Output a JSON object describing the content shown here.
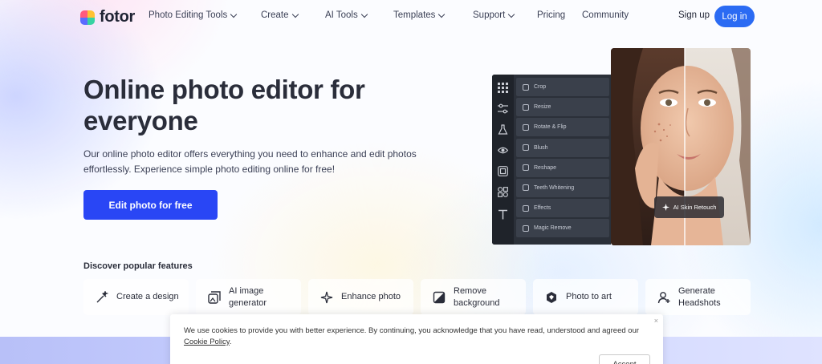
{
  "nav": {
    "logo_text": "fotor",
    "items": [
      {
        "label": "Photo Editing Tools",
        "dropdown": true
      },
      {
        "label": "Create",
        "dropdown": true
      },
      {
        "label": "AI Tools",
        "dropdown": true
      },
      {
        "label": "Templates",
        "dropdown": true
      },
      {
        "label": "Support",
        "dropdown": true
      },
      {
        "label": "Pricing",
        "dropdown": false
      },
      {
        "label": "Community",
        "dropdown": false
      }
    ],
    "signup": "Sign up",
    "login": "Log in"
  },
  "hero": {
    "title": "Online photo editor for everyone",
    "description": "Our online photo editor offers everything you need to enhance and edit photos effortlessly. Experience simple photo editing online for free!",
    "cta": "Edit photo for free"
  },
  "editor_mock": {
    "rail_icons": [
      "grid-icon",
      "sliders-icon",
      "flask-icon",
      "eye-icon",
      "frame-icon",
      "shapes-icon",
      "text-icon"
    ],
    "tools": [
      "Crop",
      "Resize",
      "Rotate & Flip",
      "Blush",
      "Reshape",
      "Teeth Whitening",
      "Effects",
      "Magic Remove"
    ],
    "badge": "AI Skin Retouch"
  },
  "features": {
    "heading": "Discover popular features",
    "cards": [
      {
        "label": "Create a design",
        "icon": "wand-icon"
      },
      {
        "label": "AI image generator",
        "icon": "ai-image-icon"
      },
      {
        "label": "Enhance photo",
        "icon": "sparkle-icon"
      },
      {
        "label": "Remove background",
        "icon": "cutout-icon"
      },
      {
        "label": "Photo to art",
        "icon": "art-icon"
      },
      {
        "label": "Generate Headshots",
        "icon": "person-icon"
      }
    ]
  },
  "cookie": {
    "text_before": "We use cookies to provide you with better experience. By continuing, you acknowledge that you have read, understood and agreed our ",
    "link": "Cookie Policy",
    "text_after": ".",
    "accept": "Accept",
    "close": "×"
  },
  "colors": {
    "primary": "#2946f5",
    "login": "#2b6bf3"
  }
}
